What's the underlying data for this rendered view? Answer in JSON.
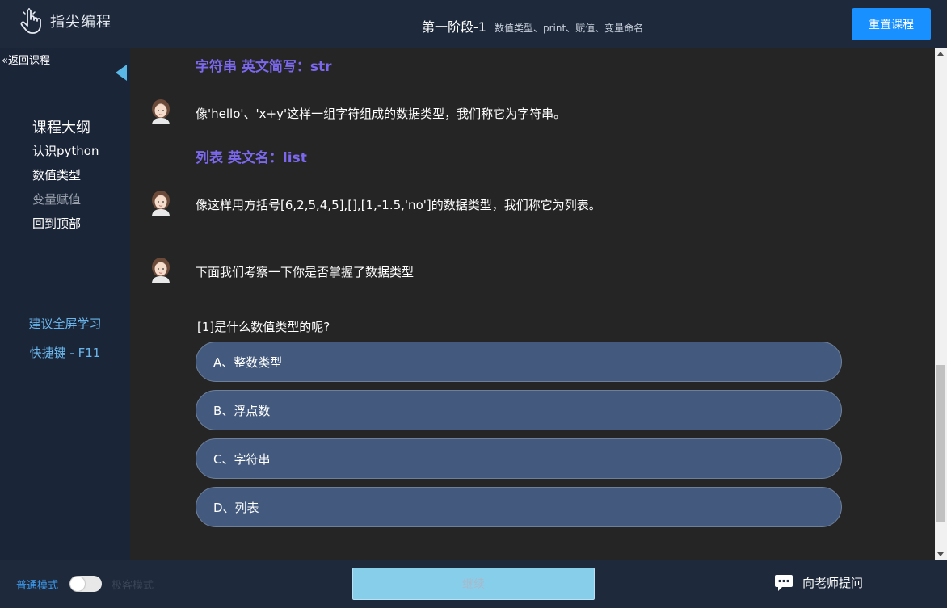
{
  "header": {
    "logo_text": "指尖编程",
    "lesson_main": "第一阶段-1",
    "lesson_sub": "数值类型、print、赋值、变量命名",
    "reset_label": "重置课程"
  },
  "sidebar": {
    "back_label": "«返回课程",
    "outline_title": "课程大纲",
    "items": [
      {
        "label": "认识python"
      },
      {
        "label": "数值类型"
      },
      {
        "label": "变量赋值"
      },
      {
        "label": "回到顶部"
      }
    ],
    "tip_fullscreen": "建议全屏学习",
    "tip_shortcut": "快捷键 - F11"
  },
  "main": {
    "heading_str": "字符串 英文简写：str",
    "msg_str": "像'hello'、'x+y'这样一组字符组成的数据类型，我们称它为字符串。",
    "heading_list": "列表 英文名：list",
    "msg_list": "像这样用方括号[6,2,5,4,5],[],[1,-1.5,'no']的数据类型，我们称它为列表。",
    "msg_quiz": "下面我们考察一下你是否掌握了数据类型",
    "question": "[1]是什么数值类型的呢?",
    "options": [
      {
        "label": "A、整数类型"
      },
      {
        "label": "B、浮点数"
      },
      {
        "label": "C、字符串"
      },
      {
        "label": "D、列表"
      }
    ]
  },
  "footer": {
    "mode_normal": "普通模式",
    "mode_other": "极客模式",
    "continue_label": "继续",
    "ask_label": "向老师提问"
  },
  "colors": {
    "accent": "#1890ff",
    "heading": "#7b68ee",
    "option_bg": "#435a7e",
    "tip": "#6ab6ec"
  }
}
